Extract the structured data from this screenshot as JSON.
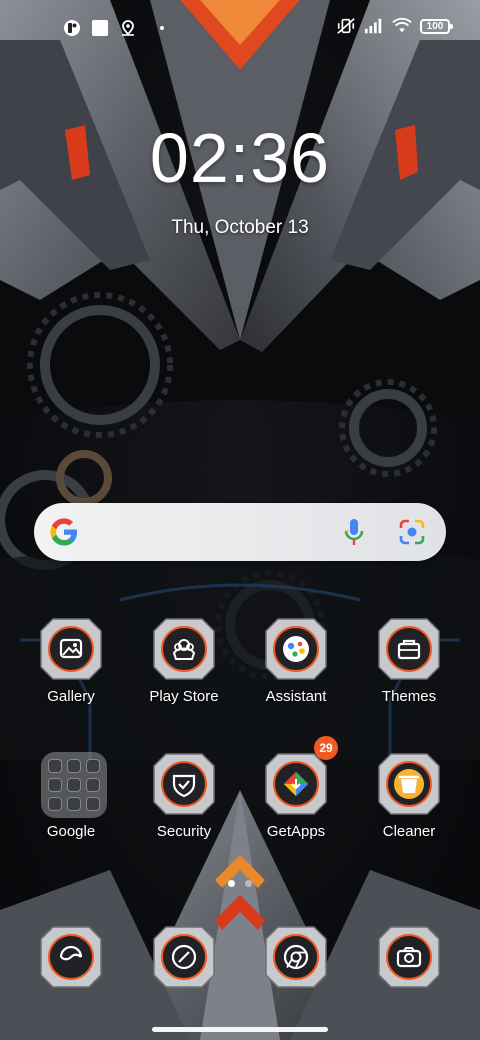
{
  "status_bar": {
    "left_icons": [
      "app-notification-icon",
      "square-notification-icon",
      "location-pin-icon",
      "more-notifications-dot"
    ],
    "right_icons": [
      "vibrate-off-icon",
      "signal-bars-icon",
      "wifi-icon"
    ],
    "battery_level": "100"
  },
  "lockscreen": {
    "time": "02:36",
    "date": "Thu, October 13"
  },
  "search": {
    "brand_icon": "google-g-icon",
    "mic_icon": "microphone-icon",
    "lens_icon": "camera-lens-icon"
  },
  "apps_row1": [
    {
      "label": "Gallery",
      "icon": "gallery-icon"
    },
    {
      "label": "Play Store",
      "icon": "play-store-icon"
    },
    {
      "label": "Assistant",
      "icon": "assistant-icon"
    },
    {
      "label": "Themes",
      "icon": "themes-icon"
    }
  ],
  "apps_row2": [
    {
      "label": "Google",
      "icon": "folder-icon"
    },
    {
      "label": "Security",
      "icon": "security-icon"
    },
    {
      "label": "GetApps",
      "icon": "getapps-icon",
      "badge": "29"
    },
    {
      "label": "Cleaner",
      "icon": "cleaner-icon"
    }
  ],
  "dock": [
    {
      "icon": "phone-icon"
    },
    {
      "icon": "messages-icon"
    },
    {
      "icon": "chrome-icon"
    },
    {
      "icon": "camera-icon"
    }
  ],
  "page_indicator": {
    "pages": 2,
    "active": 1
  },
  "colors": {
    "accent_orange": "#f05a23",
    "badge": "#f05a23",
    "icon_frame": "#c8c9cc"
  }
}
